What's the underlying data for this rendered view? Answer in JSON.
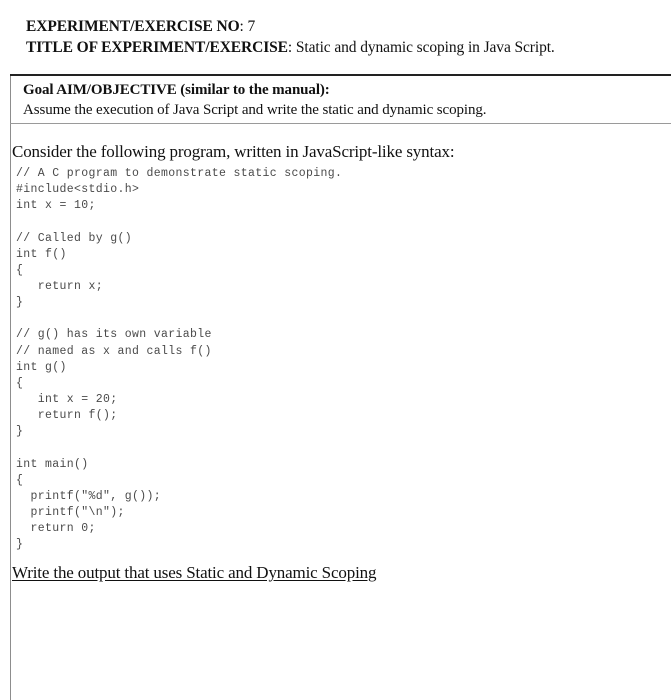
{
  "header": {
    "experiment_no_label": "EXPERIMENT/EXERCISE NO",
    "experiment_no_value": ": 7",
    "title_label": "TITLE OF EXPERIMENT/EXERCISE",
    "title_value": ": Static and dynamic scoping in Java Script."
  },
  "goal": {
    "title": "Goal AIM/OBJECTIVE (similar to the manual):",
    "description": "Assume the execution of Java Script and write the static and dynamic scoping."
  },
  "body": {
    "lead_heading": "Consider the following program, written in JavaScript-like syntax:",
    "code_lines": [
      "// A C program to demonstrate static scoping.",
      "#include<stdio.h>",
      "int x = 10;",
      "",
      "// Called by g()",
      "int f()",
      "{",
      "   return x;",
      "}",
      "",
      "// g() has its own variable",
      "// named as x and calls f()",
      "int g()",
      "{",
      "   int x = 20;",
      "   return f();",
      "}",
      "",
      "int main()",
      "{",
      "  printf(\"%d\", g());",
      "  printf(\"\\n\");",
      "  return 0;",
      "}"
    ],
    "closing_heading": "Write the output that uses Static and Dynamic Scoping"
  },
  "colors": {
    "page_background": "#ffffff",
    "text": "#111111",
    "code_text": "#4a4a4a",
    "rule": "#8d8d8d",
    "box_top_border": "#222222"
  }
}
